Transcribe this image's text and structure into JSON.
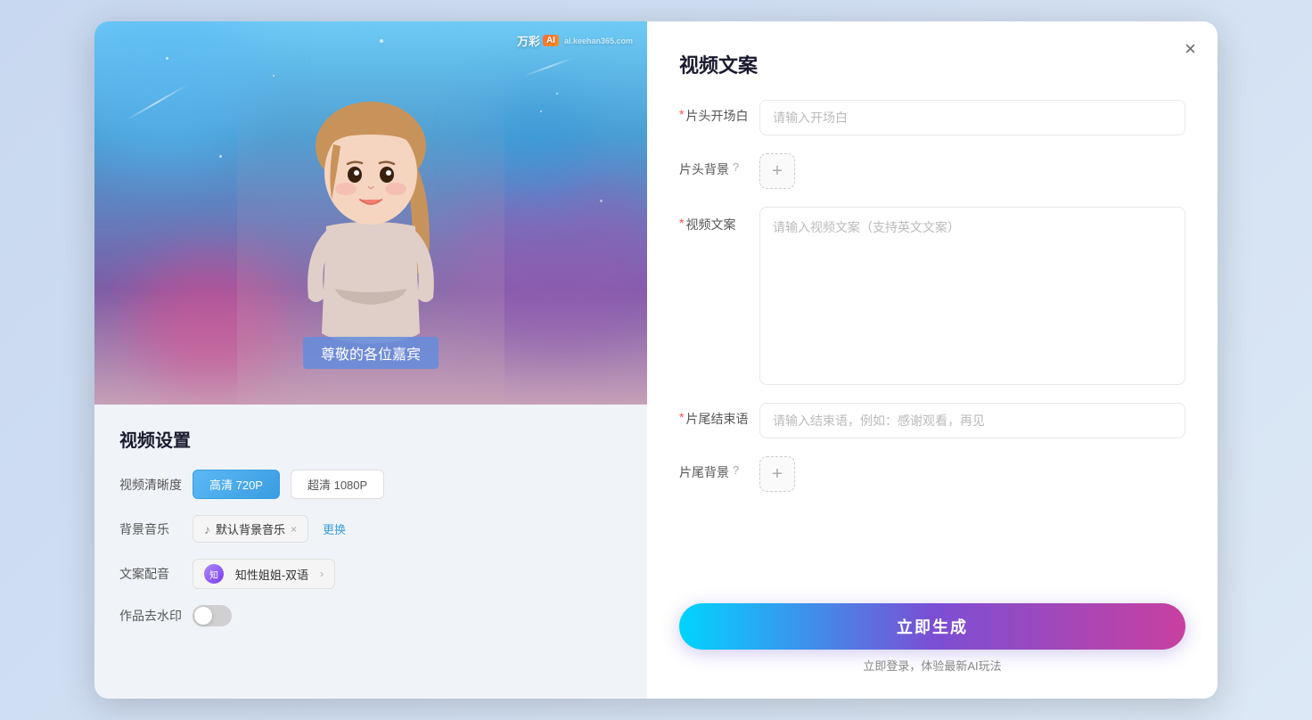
{
  "background": {
    "color": "#e8eef5"
  },
  "modal": {
    "left_panel": {
      "preview": {
        "watermark_text": "万彩",
        "watermark_ai": "AI",
        "watermark_sub": "ai.keehan365.com",
        "subtitle": "尊敬的各位嘉宾"
      },
      "settings": {
        "title": "视频设置",
        "quality_label": "视频清晰度",
        "quality_options": [
          {
            "label": "高清 720P",
            "active": true
          },
          {
            "label": "超清 1080P",
            "active": false
          }
        ],
        "music_label": "背景音乐",
        "music_value": "默认背景音乐",
        "music_change_btn": "更换",
        "voice_label": "文案配音",
        "voice_value": "知性姐姐-双语",
        "watermark_label": "作品去水印",
        "watermark_toggle": false
      }
    },
    "right_panel": {
      "title": "视频文案",
      "close_btn": "×",
      "fields": {
        "opening_label": "片头开场白",
        "opening_placeholder": "请输入开场白",
        "header_bg_label": "片头背景",
        "video_content_label": "视频文案",
        "video_content_placeholder": "请输入视频文案（支持英文文案）",
        "ending_label": "片尾结束语",
        "ending_placeholder": "请输入结束语，例如：感谢观看，再见",
        "footer_bg_label": "片尾背景"
      },
      "generate_btn": "立即生成",
      "login_hint": "立即登录，体验最新AI玩法"
    }
  }
}
